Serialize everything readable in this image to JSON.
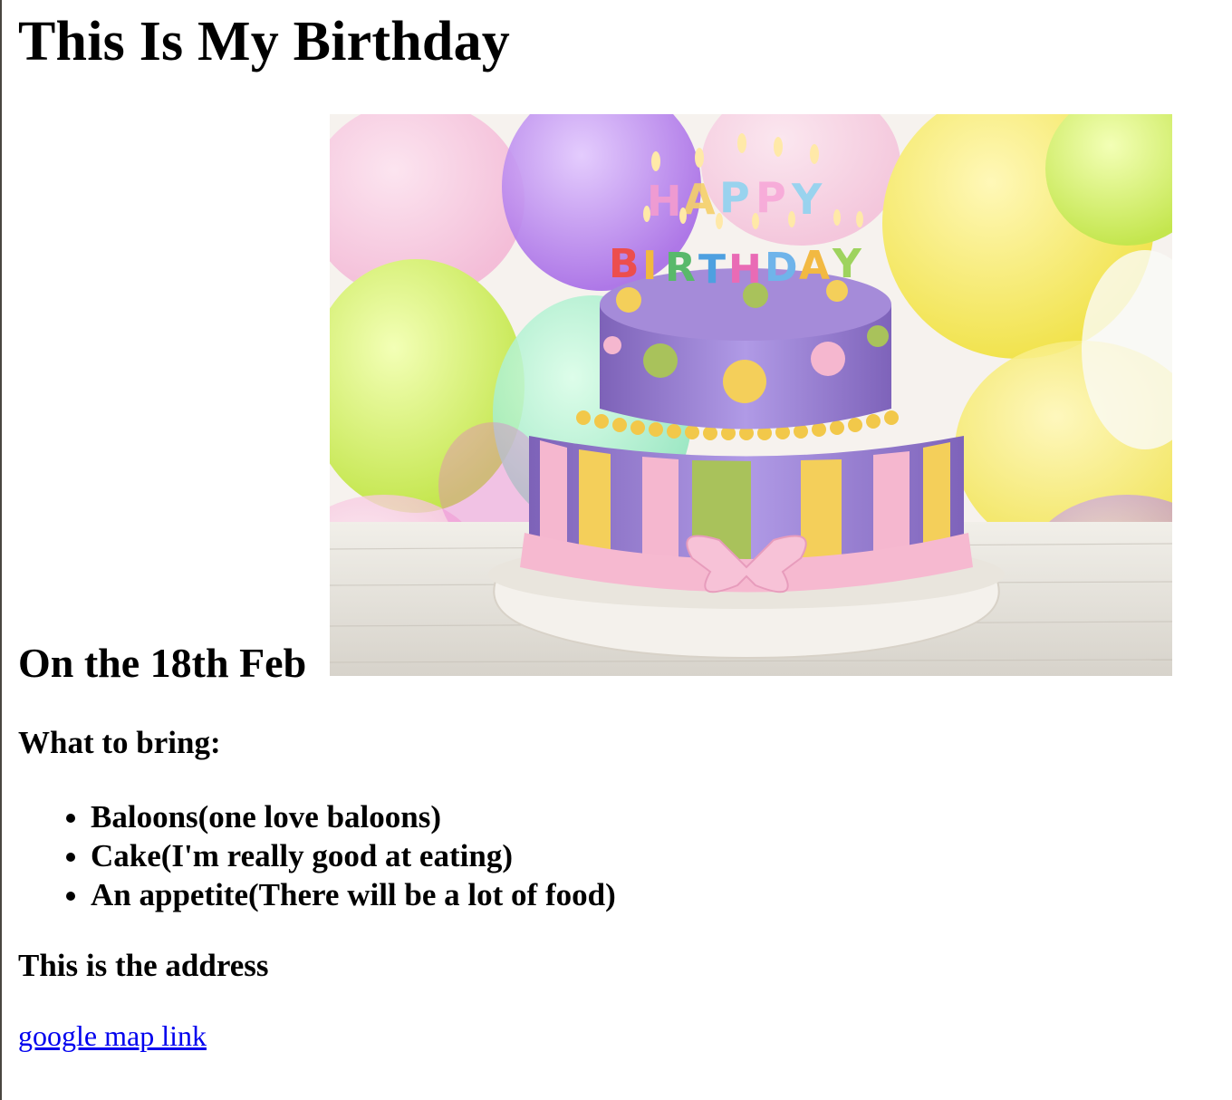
{
  "heading": "This Is My Birthday",
  "date_heading": "On the 18th Feb",
  "image": {
    "alt": "birthday cake",
    "candle_letters_top": [
      "H",
      "A",
      "P",
      "P",
      "Y"
    ],
    "candle_letters_bottom": [
      "B",
      "I",
      "R",
      "T",
      "H",
      "D",
      "A",
      "Y"
    ]
  },
  "bring": {
    "title": "What to bring:",
    "items": [
      "Baloons(one love baloons)",
      "Cake(I'm really good at eating)",
      "An appetite(There will be a lot of food)"
    ]
  },
  "address": {
    "title": "This is the address",
    "link_label": "google map link"
  },
  "colors": {
    "link": "#0000ee",
    "text": "#000000",
    "cake_purple": "#9b7fd1",
    "cake_pink": "#f5b7cf",
    "cake_yellow": "#f4cf5a",
    "cake_green": "#a9c25b"
  }
}
